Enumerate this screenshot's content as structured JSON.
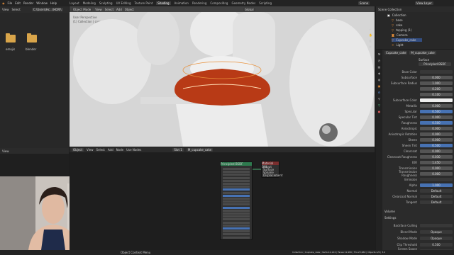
{
  "topbar": {
    "menus": [
      "File",
      "Edit",
      "Render",
      "Window",
      "Help"
    ],
    "workspaces": [
      "Layout",
      "Modeling",
      "Sculpting",
      "UV Editing",
      "Texture Paint",
      "Shading",
      "Animation",
      "Rendering",
      "Compositing",
      "Geometry Nodes",
      "Scripting"
    ],
    "active_workspace": "Shading",
    "scene": "Scene",
    "view_layer": "View Layer"
  },
  "filebrowser": {
    "header": [
      "View",
      "Select"
    ],
    "path": "C:\\Users\\Hc...\\HDRI\\",
    "folders": [
      "emojis",
      "blender"
    ]
  },
  "viewport": {
    "mode": "Object Mode",
    "menus": [
      "View",
      "Select",
      "Add",
      "Object"
    ],
    "view_label": "User Perspective",
    "collection_label": "(1) Collection | cupcake_cake",
    "shading": "Global"
  },
  "outliner": {
    "title": "Scene Collection",
    "items": [
      "Collection",
      "base",
      "cake",
      "topping (1)",
      "Camera",
      "Cupcake_cake",
      "Light"
    ]
  },
  "props": {
    "object": "Cupcake_cake",
    "material": "M_cupcake_cake",
    "surface": "Surface",
    "shader": "Principled BSDF",
    "rows": [
      {
        "label": "Base Color",
        "value": "",
        "style": "dark"
      },
      {
        "label": "Subsurface",
        "value": "0.000",
        "style": ""
      },
      {
        "label": "Subsurface Radius",
        "value": "1.000",
        "style": ""
      },
      {
        "label": "",
        "value": "0.200",
        "style": ""
      },
      {
        "label": "",
        "value": "0.100",
        "style": ""
      },
      {
        "label": "Subsurface Color",
        "value": "",
        "style": "white"
      },
      {
        "label": "Metallic",
        "value": "0.000",
        "style": ""
      },
      {
        "label": "Specular",
        "value": "0.500",
        "style": "blue"
      },
      {
        "label": "Specular Tint",
        "value": "0.000",
        "style": ""
      },
      {
        "label": "Roughness",
        "value": "0.500",
        "style": "blue"
      },
      {
        "label": "Anisotropic",
        "value": "0.000",
        "style": ""
      },
      {
        "label": "Anisotropic Rotation",
        "value": "0.000",
        "style": ""
      },
      {
        "label": "Sheen",
        "value": "0.000",
        "style": ""
      },
      {
        "label": "Sheen Tint",
        "value": "0.500",
        "style": "blue"
      },
      {
        "label": "Clearcoat",
        "value": "0.000",
        "style": ""
      },
      {
        "label": "Clearcoat Roughness",
        "value": "0.030",
        "style": ""
      },
      {
        "label": "IOR",
        "value": "1.450",
        "style": ""
      },
      {
        "label": "Transmission",
        "value": "0.000",
        "style": ""
      },
      {
        "label": "Transmission Roughness",
        "value": "0.000",
        "style": ""
      },
      {
        "label": "Emission",
        "value": "",
        "style": "dark"
      },
      {
        "label": "Alpha",
        "value": "1.000",
        "style": "blue"
      },
      {
        "label": "Normal",
        "value": "Default",
        "style": "dark"
      },
      {
        "label": "Clearcoat Normal",
        "value": "Default",
        "style": "dark"
      },
      {
        "label": "Tangent",
        "value": "Default",
        "style": "dark"
      }
    ],
    "sections": [
      "Volume",
      "Settings"
    ],
    "settings": [
      {
        "label": "Backface Culling",
        "value": ""
      },
      {
        "label": "Blend Mode",
        "value": "Opaque"
      },
      {
        "label": "Shadow Mode",
        "value": "Opaque"
      },
      {
        "label": "Clip Threshold",
        "value": "0.500"
      },
      {
        "label": "Screen Space Refraction",
        "value": ""
      }
    ]
  },
  "node_editor": {
    "mode": "Object",
    "menus": [
      "View",
      "Select",
      "Add",
      "Node"
    ],
    "use_nodes": "Use Nodes",
    "slot": "Slot 1",
    "material": "M_cupcake_cake",
    "node1_title": "Principled BSDF",
    "node2_title": "Material Output",
    "node2_items": [
      "All",
      "Surface",
      "Volume",
      "Displacement"
    ]
  },
  "leftlow": {
    "header": [
      "View"
    ]
  },
  "status": {
    "left": "Object Context Menu",
    "right": "Collection | Cupcake_cake | Verts:12,124 | Faces:11,980 | Tris:23,960 | Objects:1/6 | 3.0"
  },
  "colors": {
    "accent": "#4772b3",
    "orange": "#e8903a",
    "frosting": "#b83a16"
  }
}
